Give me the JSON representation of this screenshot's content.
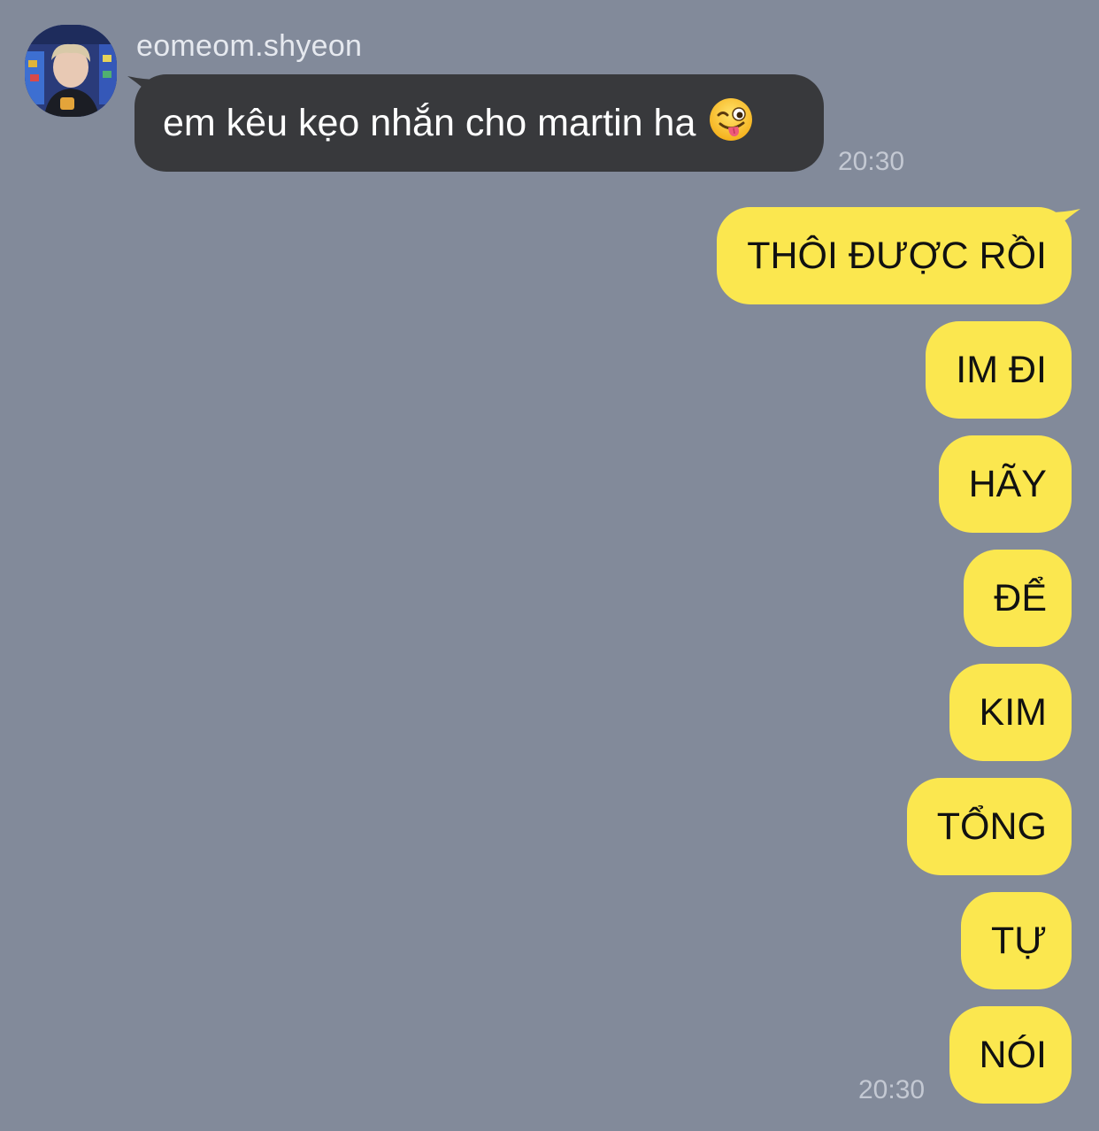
{
  "incoming": {
    "sender_name": "eomeom.shyeon",
    "text": "em kêu kẹo nhắn cho martin ha",
    "emoji": "winking-face-with-tongue",
    "time": "20:30"
  },
  "outgoing": {
    "messages": [
      {
        "text": "THÔI ĐƯỢC RỒI"
      },
      {
        "text": "IM ĐI"
      },
      {
        "text": "HÃY"
      },
      {
        "text": "ĐỂ"
      },
      {
        "text": "KIM"
      },
      {
        "text": "TỔNG"
      },
      {
        "text": "TỰ"
      },
      {
        "text": "NÓI"
      }
    ],
    "time": "20:30"
  },
  "colors": {
    "background": "#828a9a",
    "incoming_bubble": "#38393c",
    "outgoing_bubble": "#fbe74f"
  }
}
